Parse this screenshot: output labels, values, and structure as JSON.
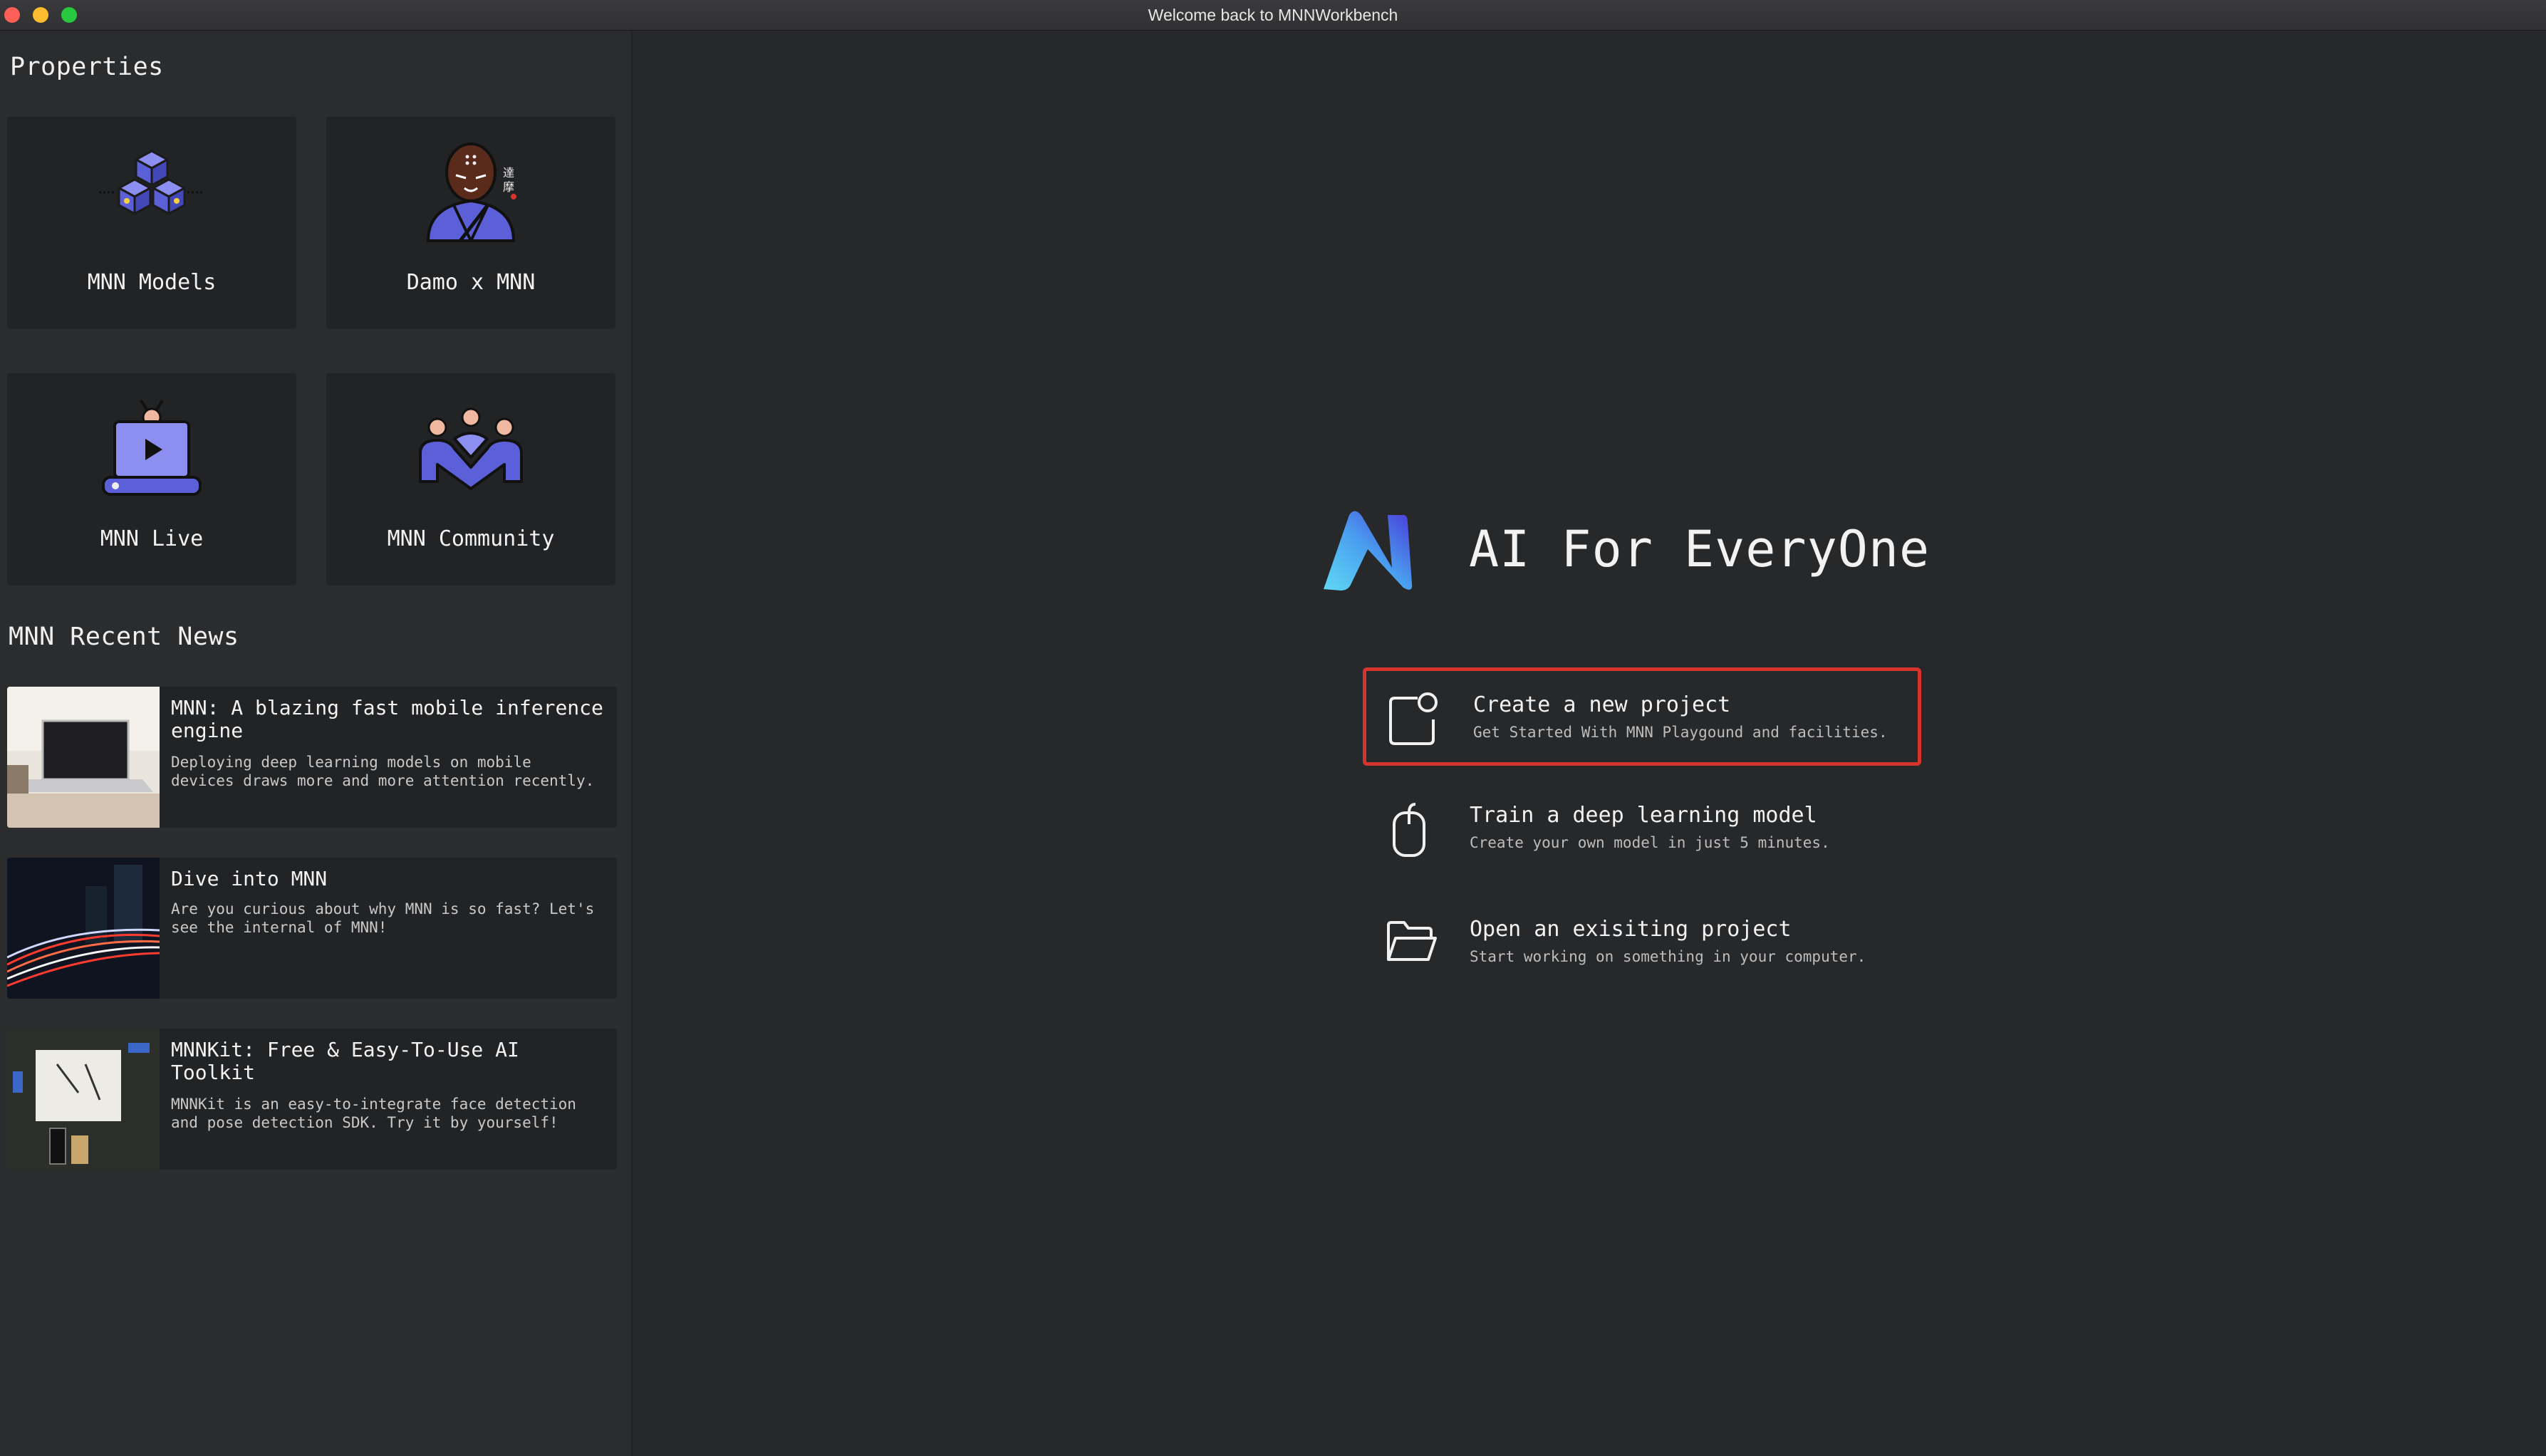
{
  "window": {
    "title": "Welcome back to MNNWorkbench"
  },
  "sidebar": {
    "properties_title": "Properties",
    "cards": [
      {
        "label": "MNN Models",
        "icon": "cubes-icon"
      },
      {
        "label": "Damo x MNN",
        "icon": "monk-icon"
      },
      {
        "label": "MNN Live",
        "icon": "live-laptop-icon"
      },
      {
        "label": "MNN Community",
        "icon": "community-icon"
      }
    ],
    "news_title": "MNN Recent News",
    "news": [
      {
        "title": "MNN: A blazing fast mobile inference engine",
        "body": "Deploying deep learning models on mobile devices draws more and more attention recently."
      },
      {
        "title": "Dive into MNN",
        "body": "Are you curious about why MNN is so fast? Let's see the internal of MNN!"
      },
      {
        "title": "MNNKit: Free & Easy-To-Use AI Toolkit",
        "body": "MNNKit is an easy-to-integrate face detection and pose detection SDK. Try it by yourself!"
      }
    ]
  },
  "main": {
    "hero_title": "AI For EveryOne",
    "actions": [
      {
        "title": "Create a new project",
        "subtitle": "Get Started With MNN Playgound and facilities.",
        "icon": "new-project-icon"
      },
      {
        "title": "Train a deep learning model",
        "subtitle": "Create your own model in just 5 minutes.",
        "icon": "mouse-icon"
      },
      {
        "title": "Open an exisiting project",
        "subtitle": "Start working on something in your computer.",
        "icon": "folder-icon"
      }
    ]
  },
  "colors": {
    "accent": "#5b5fd8",
    "highlight_border": "#d6342c",
    "background": "#27282a"
  }
}
